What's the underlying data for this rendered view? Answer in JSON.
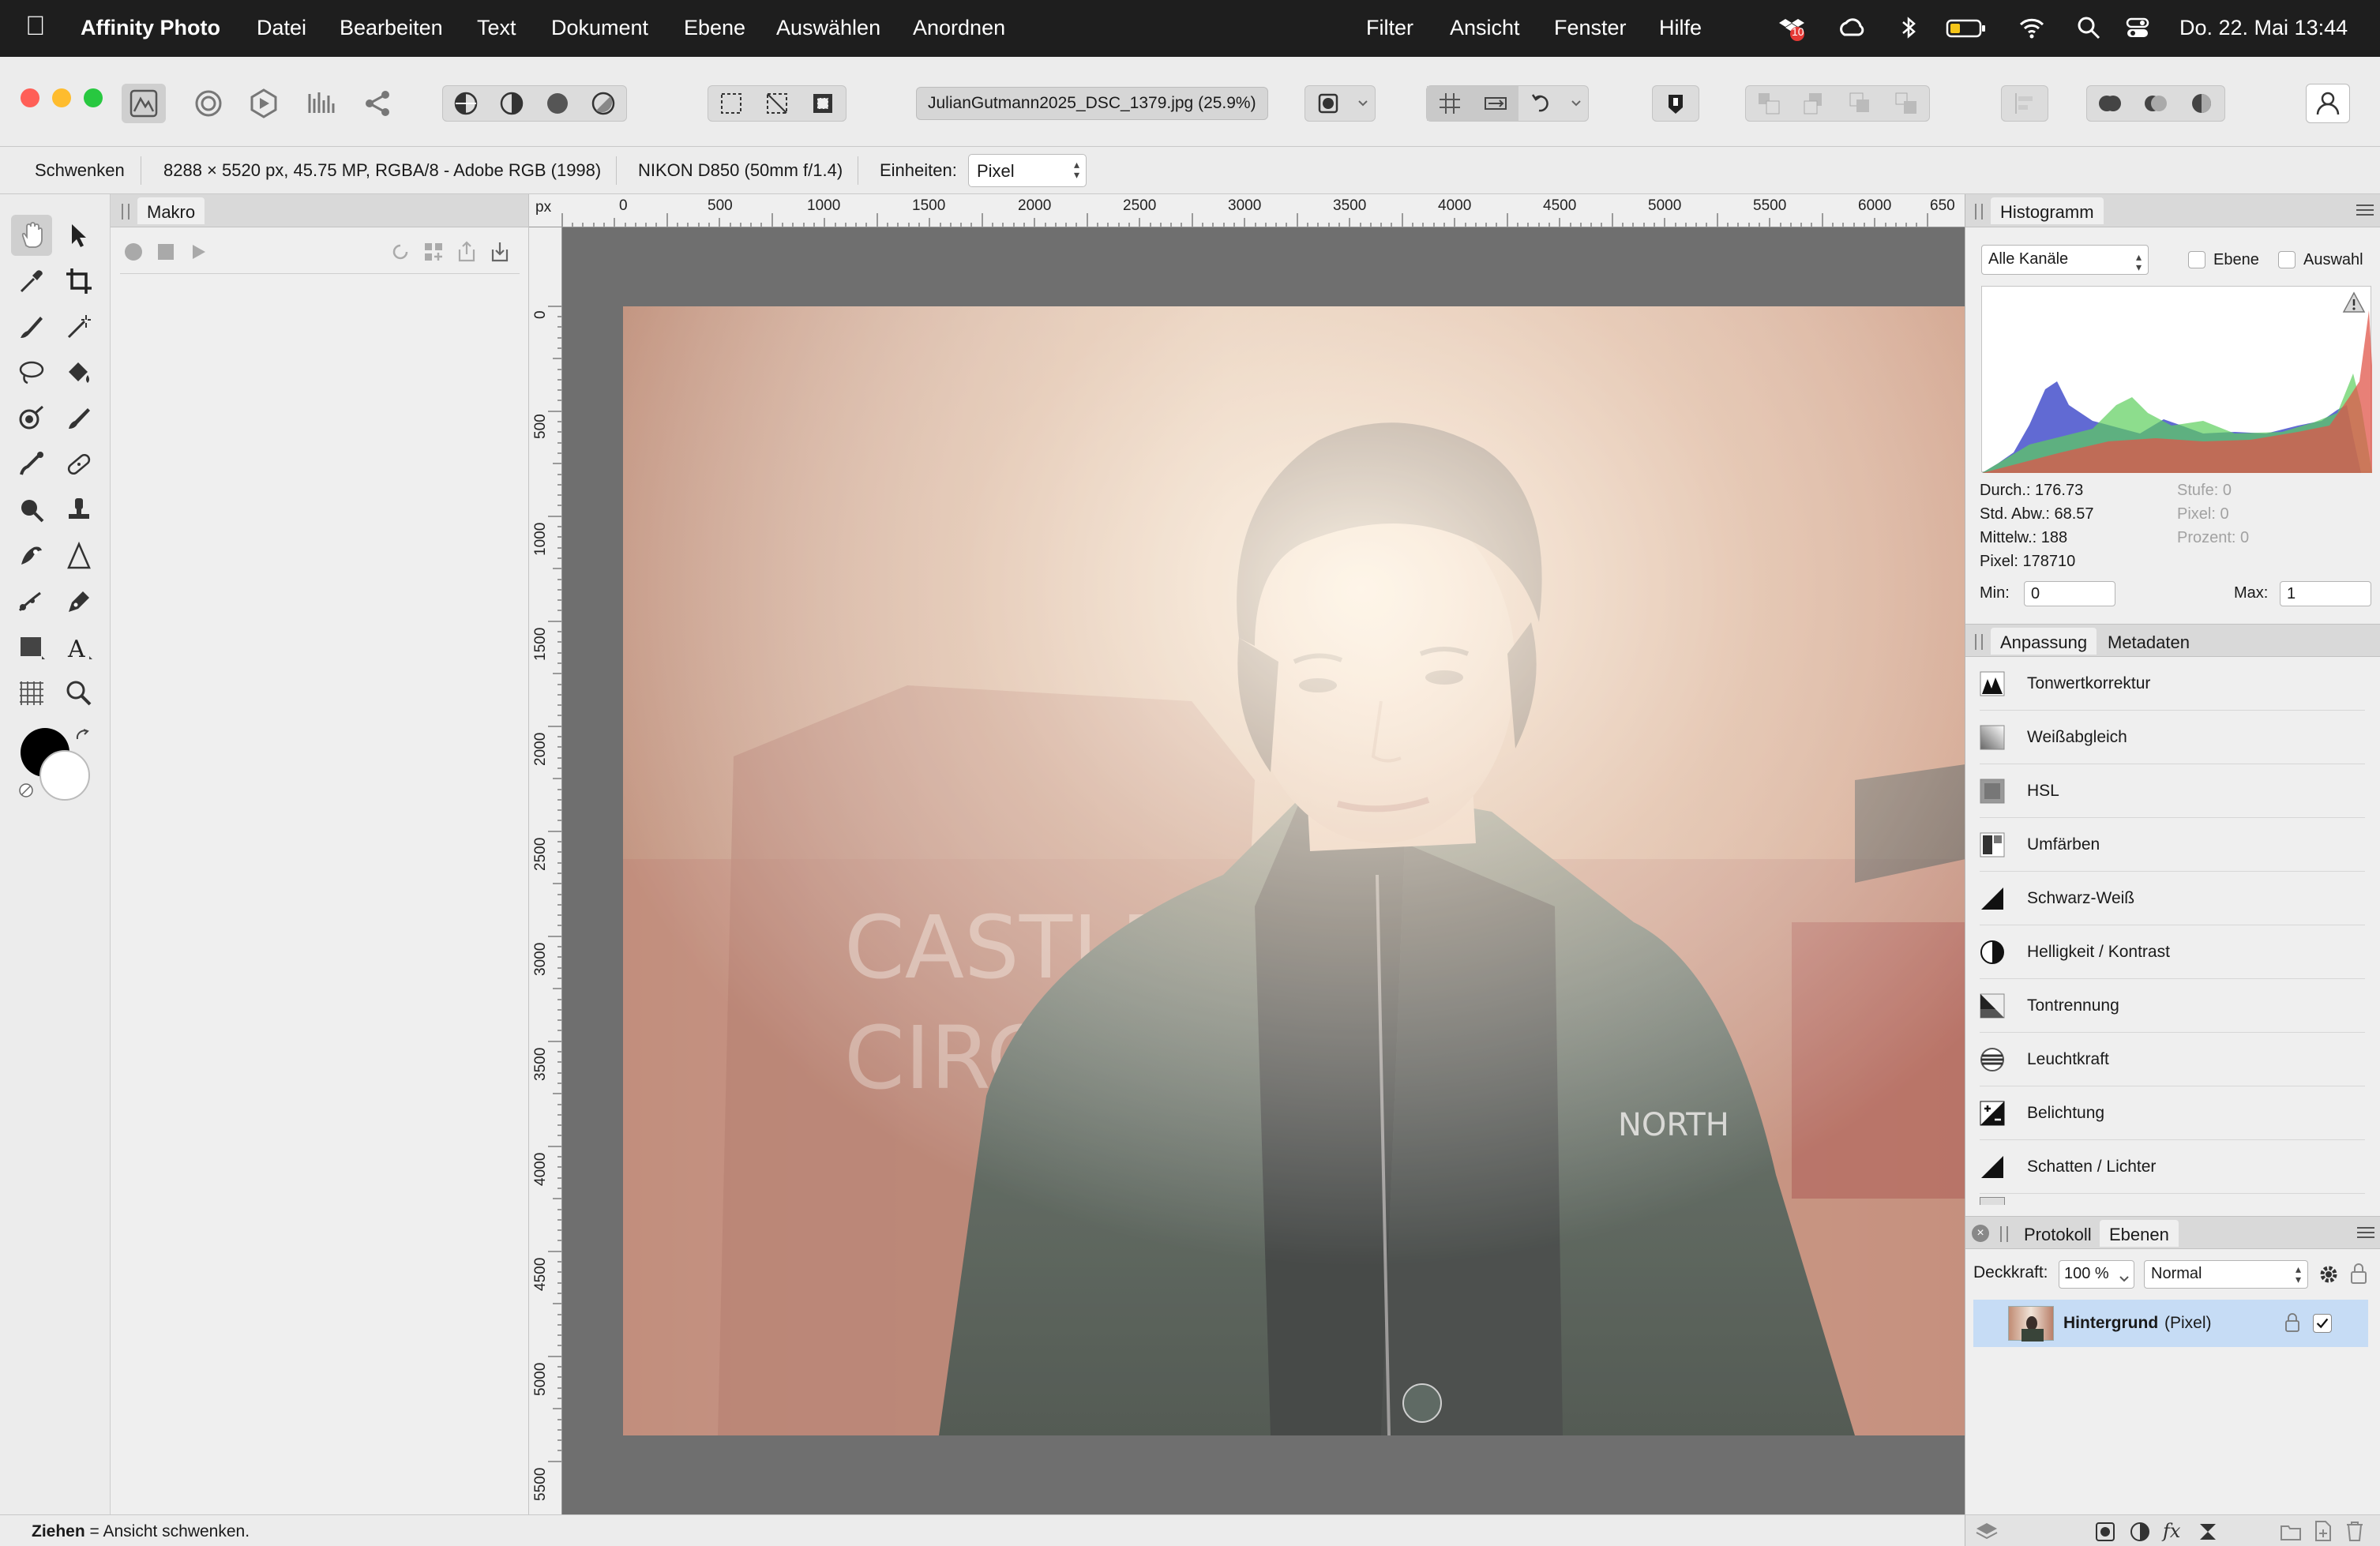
{
  "menubar": {
    "app_name": "Affinity Photo",
    "items": [
      "Datei",
      "Bearbeiten",
      "Text",
      "Dokument",
      "Ebene",
      "Auswählen",
      "Anordnen",
      "Filter",
      "Ansicht",
      "Fenster",
      "Hilfe"
    ],
    "badge_count": "10",
    "clock": "Do. 22. Mai  13:44"
  },
  "toolbar": {
    "document_title": "JulianGutmann2025_DSC_1379.jpg (25.9%)"
  },
  "contextbar": {
    "tool_name": "Schwenken",
    "image_info": "8288 × 5520 px, 45.75 MP, RGBA/8 - Adobe RGB (1998)",
    "camera_info": "NIKON D850 (50mm f/1.4)",
    "units_label": "Einheiten:",
    "units_value": "Pixel"
  },
  "makro_panel": {
    "tab_label": "Makro"
  },
  "rulers": {
    "unit": "px",
    "top_labels": [
      "0",
      "500",
      "1000",
      "1500",
      "2000",
      "2500",
      "3000",
      "3500",
      "4000",
      "4500",
      "5000",
      "5500",
      "6000",
      "650"
    ],
    "left_labels": [
      "0",
      "500",
      "1000",
      "1500",
      "2000",
      "2500",
      "3000",
      "3500",
      "4000",
      "4500",
      "5000",
      "5500"
    ]
  },
  "histogram": {
    "tab_label": "Histogramm",
    "channel_select": "Alle Kanäle",
    "layer_check_label": "Ebene",
    "selection_check_label": "Auswahl",
    "stats_left": [
      "Durch.: 176.73",
      "Std. Abw.: 68.57",
      "Mittelw.: 188",
      "Pixel: 178710"
    ],
    "stats_right": [
      "Stufe: 0",
      "Pixel: 0",
      "Prozent: 0"
    ],
    "min_label": "Min:",
    "min_value": "0",
    "max_label": "Max:",
    "max_value": "1"
  },
  "adjustments": {
    "tabs": [
      "Anpassung",
      "Metadaten"
    ],
    "items": [
      "Tonwertkorrektur",
      "Weißabgleich",
      "HSL",
      "Umfärben",
      "Schwarz-Weiß",
      "Helligkeit / Kontrast",
      "Tontrennung",
      "Leuchtkraft",
      "Belichtung",
      "Schatten / Lichter"
    ]
  },
  "layers": {
    "tabs": [
      "Protokoll",
      "Ebenen"
    ],
    "opacity_label": "Deckkraft:",
    "opacity_value": "100 %",
    "blend_mode": "Normal",
    "layer_name": "Hintergrund",
    "layer_type": "(Pixel)"
  },
  "statusbar": {
    "hint_bold": "Ziehen",
    "hint_text": " = Ansicht schwenken."
  },
  "colors": {
    "menubar_bg": "#1e1e1e",
    "canvas_bg": "#6f6f6f",
    "selected_layer": "#c6dcf5",
    "accent_blue": "#1a73e8"
  }
}
